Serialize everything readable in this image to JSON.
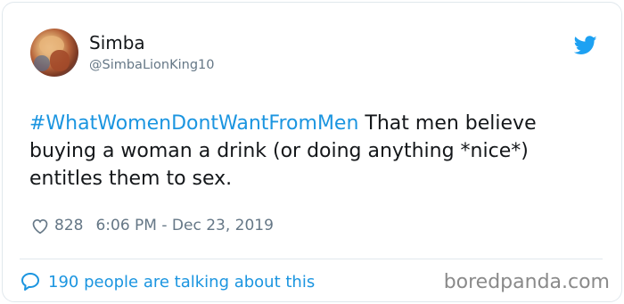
{
  "tweet": {
    "display_name": "Simba",
    "handle": "@SimbaLionKing10",
    "hashtag": "#WhatWomenDontWantFromMen",
    "body": " That men believe buying a woman a drink (or doing anything *nice*) entitles them to sex.",
    "likes": "828",
    "timestamp": "6:06 PM - Dec 23, 2019",
    "talking": "190 people are talking about this"
  },
  "watermark": "boredpanda.com",
  "colors": {
    "link": "#1b95e0",
    "muted": "#657786",
    "text": "#14171a",
    "border": "#e1e8ed"
  },
  "icons": {
    "brand": "twitter-bird-icon",
    "like": "heart-icon",
    "reply": "speech-bubble-icon"
  }
}
